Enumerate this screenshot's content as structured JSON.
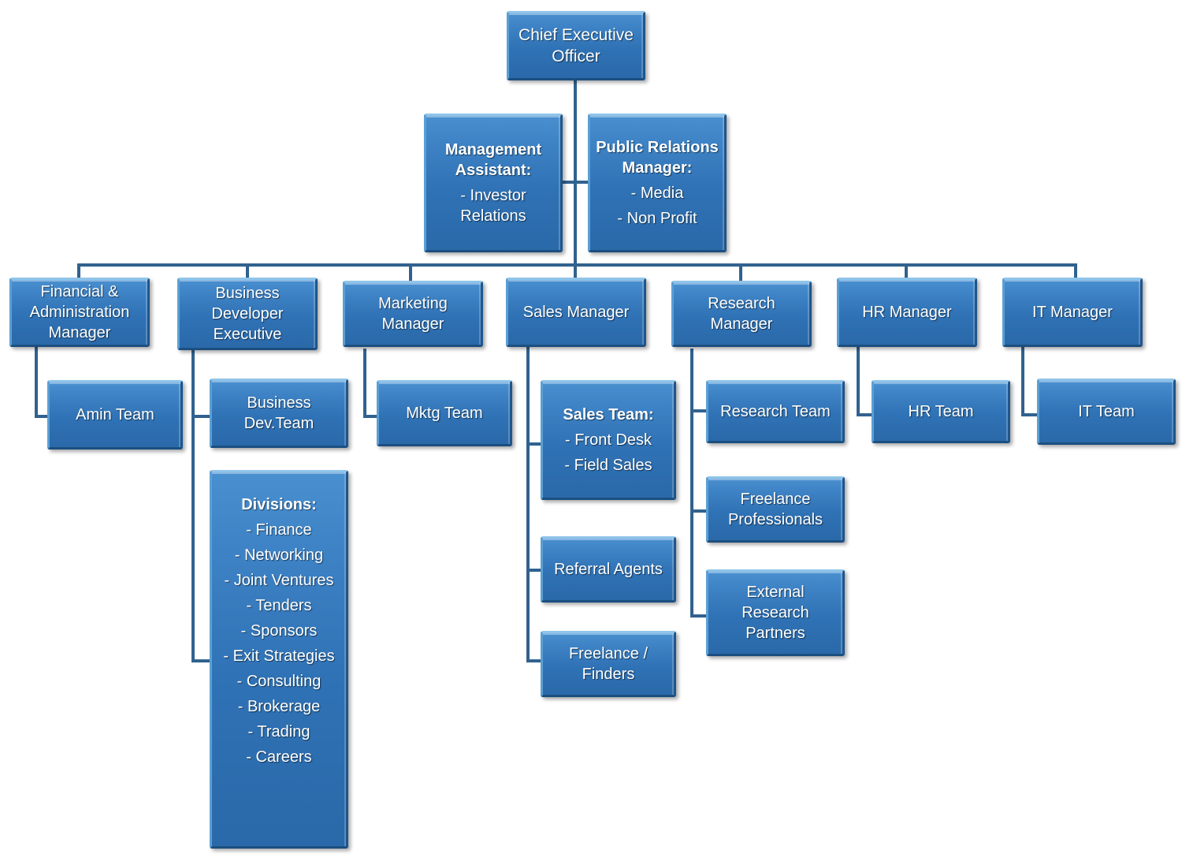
{
  "chart_data": {
    "type": "diagram",
    "title": "Company Organizational Chart",
    "accent_color": "#2f72b5",
    "connector_color": "#31628f",
    "text_color": "#ffffff"
  },
  "nodes": {
    "ceo": {
      "label": "Chief Executive Officer"
    },
    "management_assistant": {
      "title": "Management Assistant:",
      "items": [
        "- Investor Relations"
      ]
    },
    "public_relations": {
      "title": "Public Relations Manager:",
      "items": [
        "- Media",
        "- Non Profit"
      ]
    },
    "financial_admin_manager": {
      "label": "Financial & Administration Manager"
    },
    "amin_team": {
      "label": "Amin  Team"
    },
    "business_developer_executive": {
      "label": "Business Developer Executive"
    },
    "business_dev_team": {
      "label": "Business Dev.Team"
    },
    "divisions": {
      "title": "Divisions:",
      "items": [
        "- Finance",
        "- Networking",
        "- Joint Ventures",
        "- Tenders",
        "- Sponsors",
        "- Exit Strategies",
        "- Consulting",
        "- Brokerage",
        "- Trading",
        "- Careers"
      ]
    },
    "marketing_manager": {
      "label": "Marketing Manager"
    },
    "mktg_team": {
      "label": "Mktg Team"
    },
    "sales_manager": {
      "label": "Sales Manager"
    },
    "sales_team": {
      "title": "Sales Team:",
      "items": [
        "- Front  Desk",
        "- Field Sales"
      ]
    },
    "referral_agents": {
      "label": "Referral Agents"
    },
    "freelance_finders": {
      "label": "Freelance / Finders"
    },
    "research_manager": {
      "label": "Research Manager"
    },
    "research_team": {
      "label": "Research Team"
    },
    "freelance_professionals": {
      "label": "Freelance Professionals"
    },
    "external_research_partners": {
      "label": "External Research Partners"
    },
    "hr_manager": {
      "label": "HR Manager"
    },
    "hr_team": {
      "label": "HR Team"
    },
    "it_manager": {
      "label": "IT Manager"
    },
    "it_team": {
      "label": "IT Team"
    }
  }
}
